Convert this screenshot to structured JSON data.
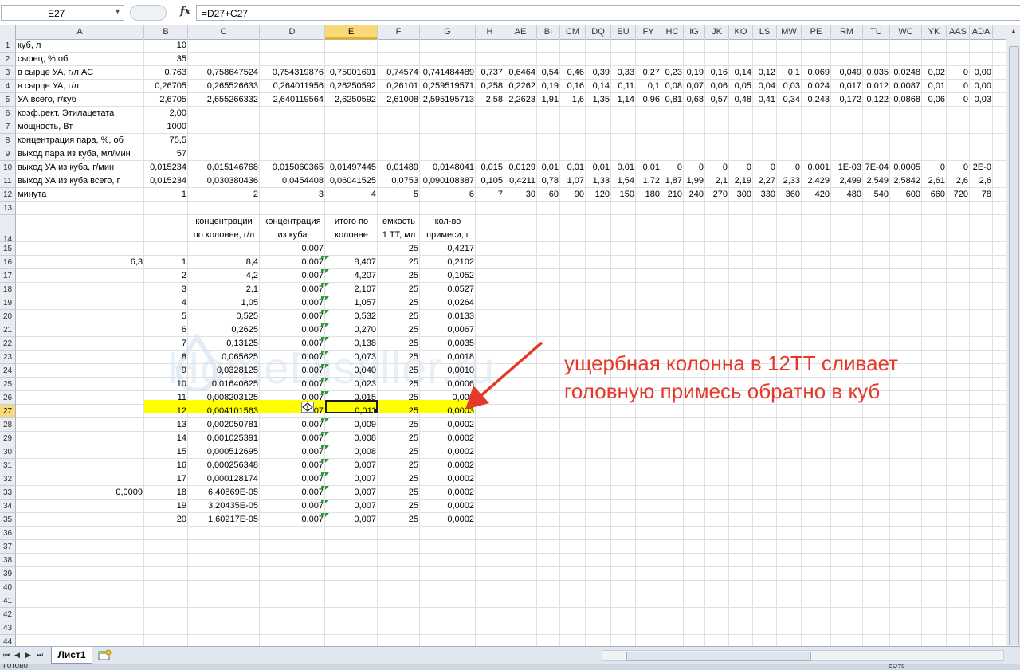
{
  "formula_bar": {
    "name_box": "E27",
    "fx_label": "fx",
    "formula": "=D27+C27"
  },
  "columns": [
    "A",
    "B",
    "C",
    "D",
    "E",
    "F",
    "G",
    "H",
    "AE",
    "BI",
    "CM",
    "DQ",
    "EU",
    "FY",
    "HC",
    "IG",
    "JK",
    "KO",
    "LS",
    "MW",
    "PE",
    "RM",
    "TU",
    "WC",
    "YK",
    "AAS",
    "ADA"
  ],
  "selected_column": "E",
  "selected_row": "27",
  "row_numbers": [
    "1",
    "2",
    "3",
    "4",
    "5",
    "6",
    "7",
    "8",
    "9",
    "10",
    "11",
    "12",
    "13",
    "14",
    "15",
    "16",
    "17",
    "18",
    "19",
    "20",
    "21",
    "22",
    "23",
    "24",
    "25",
    "26",
    "27",
    "28",
    "29",
    "30",
    "31",
    "32",
    "33",
    "34",
    "35",
    "36",
    "37",
    "38",
    "39",
    "40",
    "41",
    "42",
    "43",
    "44"
  ],
  "top_rows": [
    {
      "label": "куб, л",
      "b": "10",
      "rest": []
    },
    {
      "label": "сырец, %.об",
      "b": "35",
      "rest": []
    },
    {
      "label": "в сырце УА, г/л АС",
      "b": "0,763",
      "rest": [
        "0,758647524",
        "0,754319876",
        "0,75001691",
        "0,74574",
        "0,741484489",
        "0,737",
        "0,6464",
        "0,54",
        "0,46",
        "0,39",
        "0,33",
        "0,27",
        "0,23",
        "0,19",
        "0,16",
        "0,14",
        "0,12",
        "0,1",
        "0,069",
        "0,049",
        "0,035",
        "0,0248",
        "0,02",
        "0",
        "0,00"
      ]
    },
    {
      "label": "в сырце УА, г/л",
      "b": "0,26705",
      "rest": [
        "0,265526633",
        "0,264011956",
        "0,26250592",
        "0,26101",
        "0,259519571",
        "0,258",
        "0,2262",
        "0,19",
        "0,16",
        "0,14",
        "0,11",
        "0,1",
        "0,08",
        "0,07",
        "0,06",
        "0,05",
        "0,04",
        "0,03",
        "0,024",
        "0,017",
        "0,012",
        "0,0087",
        "0,01",
        "0",
        "0,00"
      ]
    },
    {
      "label": "УА всего, г/куб",
      "b": "2,6705",
      "rest": [
        "2,655266332",
        "2,640119564",
        "2,6250592",
        "2,61008",
        "2,595195713",
        "2,58",
        "2,2623",
        "1,91",
        "1,6",
        "1,35",
        "1,14",
        "0,96",
        "0,81",
        "0,68",
        "0,57",
        "0,48",
        "0,41",
        "0,34",
        "0,243",
        "0,172",
        "0,122",
        "0,0868",
        "0,06",
        "0",
        "0,03"
      ]
    },
    {
      "label": "коэф.рект. Этилацетата",
      "b": "2,00",
      "rest": []
    },
    {
      "label": "мощность, Вт",
      "b": "1000",
      "rest": []
    },
    {
      "label": "концентрация пара, %, об",
      "b": "75,5",
      "rest": []
    },
    {
      "label": "выход пара из куба, мл/мин",
      "b": "57",
      "rest": []
    },
    {
      "label": "выход УА из куба, г/мин",
      "b": "0,015234",
      "rest": [
        "0,015146768",
        "0,015060365",
        "0,01497445",
        "0,01489",
        "0,0148041",
        "0,015",
        "0,0129",
        "0,01",
        "0,01",
        "0,01",
        "0,01",
        "0,01",
        "0",
        "0",
        "0",
        "0",
        "0",
        "0",
        "0,001",
        "1E-03",
        "7E-04",
        "0,0005",
        "0",
        "0",
        "2E-0"
      ]
    },
    {
      "label": "выход УА из куба всего, г",
      "b": "0,015234",
      "rest": [
        "0,030380436",
        "0,0454408",
        "0,06041525",
        "0,0753",
        "0,090108387",
        "0,105",
        "0,4211",
        "0,78",
        "1,07",
        "1,33",
        "1,54",
        "1,72",
        "1,87",
        "1,99",
        "2,1",
        "2,19",
        "2,27",
        "2,33",
        "2,429",
        "2,499",
        "2,549",
        "2,5842",
        "2,61",
        "2,6",
        "2,6"
      ]
    },
    {
      "label": "минута",
      "b": "1",
      "rest": [
        "2",
        "3",
        "4",
        "5",
        "6",
        "7",
        "30",
        "60",
        "90",
        "120",
        "150",
        "180",
        "210",
        "240",
        "270",
        "300",
        "330",
        "360",
        "420",
        "480",
        "540",
        "600",
        "660",
        "720",
        "78"
      ]
    }
  ],
  "table_headers": {
    "c": [
      "концентрации",
      "по колонне, г/л"
    ],
    "d": [
      "концентрация",
      "из куба"
    ],
    "e": [
      "итого по",
      "колонне"
    ],
    "f": [
      "емкость",
      "1 ТТ, мл"
    ],
    "g": [
      "кол-во",
      "примеси, г"
    ]
  },
  "table_rows": [
    {
      "a": "",
      "b": "",
      "c": "",
      "d": "0,007",
      "e": "",
      "f": "25",
      "g": "0,4217"
    },
    {
      "a": "6,3",
      "b": "1",
      "c": "8,4",
      "d": "0,007",
      "e": "8,407",
      "f": "25",
      "g": "0,2102"
    },
    {
      "a": "",
      "b": "2",
      "c": "4,2",
      "d": "0,007",
      "e": "4,207",
      "f": "25",
      "g": "0,1052"
    },
    {
      "a": "",
      "b": "3",
      "c": "2,1",
      "d": "0,007",
      "e": "2,107",
      "f": "25",
      "g": "0,0527"
    },
    {
      "a": "",
      "b": "4",
      "c": "1,05",
      "d": "0,007",
      "e": "1,057",
      "f": "25",
      "g": "0,0264"
    },
    {
      "a": "",
      "b": "5",
      "c": "0,525",
      "d": "0,007",
      "e": "0,532",
      "f": "25",
      "g": "0,0133"
    },
    {
      "a": "",
      "b": "6",
      "c": "0,2625",
      "d": "0,007",
      "e": "0,270",
      "f": "25",
      "g": "0,0067"
    },
    {
      "a": "",
      "b": "7",
      "c": "0,13125",
      "d": "0,007",
      "e": "0,138",
      "f": "25",
      "g": "0,0035"
    },
    {
      "a": "",
      "b": "8",
      "c": "0,065625",
      "d": "0,007",
      "e": "0,073",
      "f": "25",
      "g": "0,0018"
    },
    {
      "a": "",
      "b": "9",
      "c": "0,0328125",
      "d": "0,007",
      "e": "0,040",
      "f": "25",
      "g": "0,0010"
    },
    {
      "a": "",
      "b": "10",
      "c": "0,01640625",
      "d": "0,007",
      "e": "0,023",
      "f": "25",
      "g": "0,0006"
    },
    {
      "a": "",
      "b": "11",
      "c": "0,008203125",
      "d": "0,007",
      "e": "0,015",
      "f": "25",
      "g": "0,000"
    },
    {
      "a": "",
      "b": "12",
      "c": "0,004101563",
      "d": "07",
      "e": "0,011",
      "f": "25",
      "g": "0,0003"
    },
    {
      "a": "",
      "b": "13",
      "c": "0,002050781",
      "d": "0,007",
      "e": "0,009",
      "f": "25",
      "g": "0,0002"
    },
    {
      "a": "",
      "b": "14",
      "c": "0,001025391",
      "d": "0,007",
      "e": "0,008",
      "f": "25",
      "g": "0,0002"
    },
    {
      "a": "",
      "b": "15",
      "c": "0,000512695",
      "d": "0,007",
      "e": "0,008",
      "f": "25",
      "g": "0,0002"
    },
    {
      "a": "",
      "b": "16",
      "c": "0,000256348",
      "d": "0,007",
      "e": "0,007",
      "f": "25",
      "g": "0,0002"
    },
    {
      "a": "",
      "b": "17",
      "c": "0,000128174",
      "d": "0,007",
      "e": "0,007",
      "f": "25",
      "g": "0,0002"
    },
    {
      "a": "0,0009",
      "b": "18",
      "c": "6,40869E-05",
      "d": "0,007",
      "e": "0,007",
      "f": "25",
      "g": "0,0002"
    },
    {
      "a": "",
      "b": "19",
      "c": "3,20435E-05",
      "d": "0,007",
      "e": "0,007",
      "f": "25",
      "g": "0,0002"
    },
    {
      "a": "",
      "b": "20",
      "c": "1,60217E-05",
      "d": "0,007",
      "e": "0,007",
      "f": "25",
      "g": "0,0002"
    }
  ],
  "annotation": [
    "ущербная колонна в 12ТТ сливает",
    "головную примесь обратно в куб"
  ],
  "watermark": "HomeDistiller.ru",
  "sheet_tab": "Лист1",
  "status": {
    "left": "Готово",
    "zoom": "85%"
  },
  "colors": {
    "highlight": "#ffff00",
    "annotation": "#e33a2a",
    "selected_header": "#f9d97a",
    "grid": "#dde1e6"
  }
}
